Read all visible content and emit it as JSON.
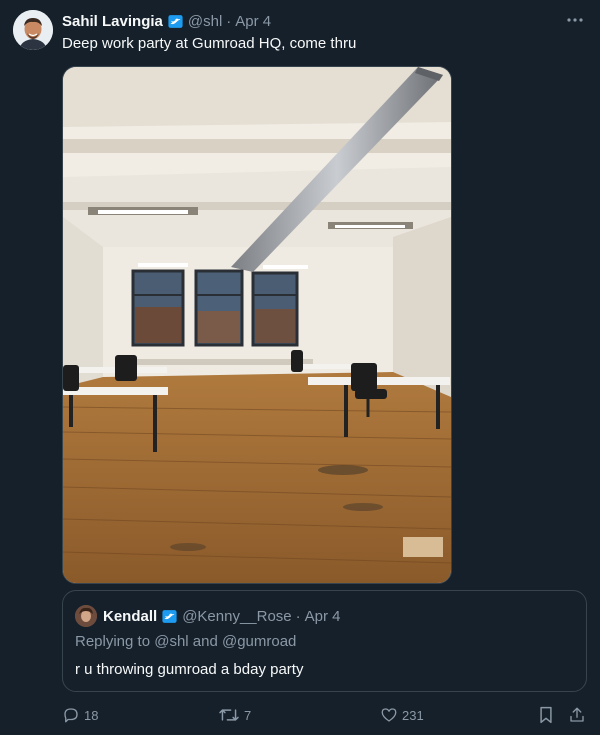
{
  "tweet": {
    "author_name": "Sahil Lavingia",
    "handle": "@shl",
    "separator": "·",
    "date": "Apr 4",
    "text": "Deep work party at Gumroad HQ, come thru",
    "icons": {
      "verified": "verified-badge-icon",
      "more": "more-options-icon"
    }
  },
  "quote": {
    "author_name": "Kendall",
    "handle": "@Kenny__Rose",
    "separator": "·",
    "date": "Apr 4",
    "replying_to": "Replying to @shl and @gumroad",
    "text": "r u throwing gumroad a bday party"
  },
  "actions": {
    "reply_count": "18",
    "retweet_count": "7",
    "like_count": "231"
  },
  "colors": {
    "background": "#15202b",
    "text": "#f7f9f9",
    "muted": "#8b98a5",
    "border": "#38444d",
    "verified": "#1d9bf0"
  }
}
